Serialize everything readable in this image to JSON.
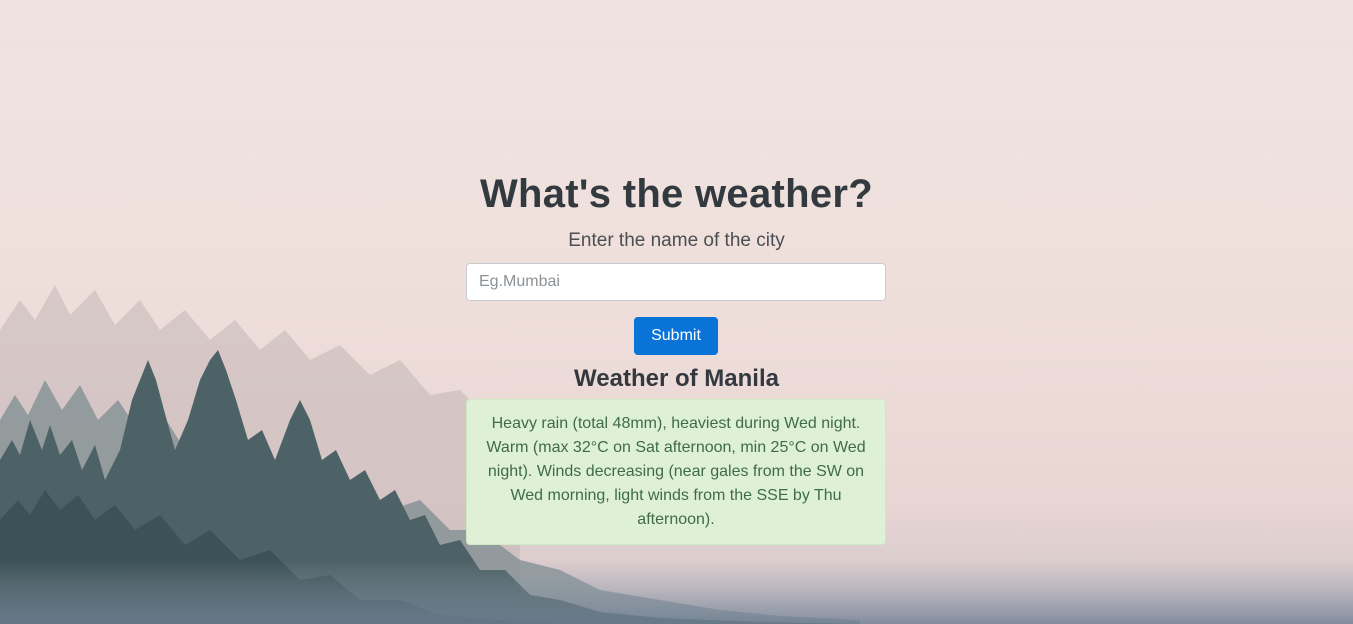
{
  "page": {
    "title": "What's the weather?",
    "subtitle": "Enter the name of the city"
  },
  "search": {
    "placeholder": "Eg.Mumbai",
    "value": "",
    "submit_label": "Submit"
  },
  "result": {
    "heading": "Weather of Manila",
    "summary": "Heavy rain (total 48mm), heaviest during Wed night. Warm (max 32°C on Sat afternoon, min 25°C on Wed night). Winds decreasing (near gales from the SW on Wed morning, light winds from the SSE by Thu afternoon)."
  },
  "colors": {
    "accent": "#0a73d8",
    "result_background": "#def1d7",
    "result_text": "#3f6b45",
    "heading_text": "#333a3f"
  }
}
